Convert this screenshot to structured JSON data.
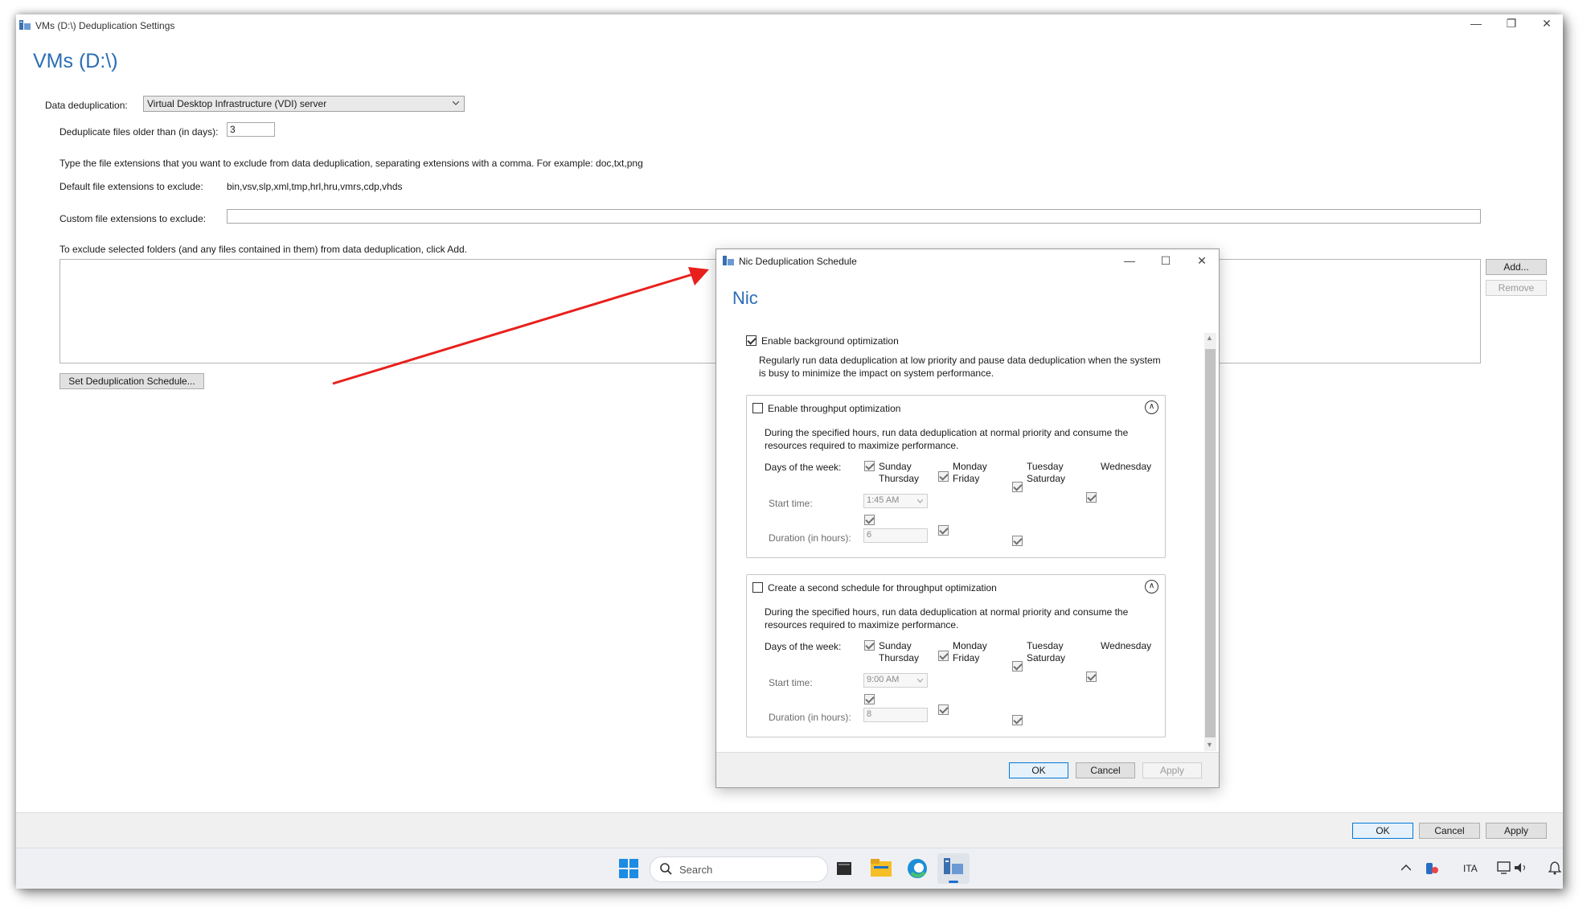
{
  "main": {
    "window_title": "VMs (D:\\) Deduplication Settings",
    "controls": {
      "minimize": "—",
      "restore": "❐",
      "close": "✕"
    },
    "heading": "VMs (D:\\)",
    "data_dedup_label": "Data deduplication:",
    "data_dedup_value": "Virtual Desktop Infrastructure (VDI) server",
    "older_than_label": "Deduplicate files older than (in days):",
    "older_than_value": "3",
    "instructions": "Type the file extensions that you want to exclude from data deduplication, separating extensions with a comma. For example: doc,txt,png",
    "default_ext_label": "Default file extensions to exclude:",
    "default_ext_value": "bin,vsv,slp,xml,tmp,hrl,hru,vmrs,cdp,vhds",
    "custom_ext_label": "Custom file extensions to exclude:",
    "custom_ext_value": "",
    "folders_instruction": "To exclude selected folders (and any files contained in them) from data deduplication, click Add.",
    "add_button": "Add...",
    "remove_button": "Remove",
    "schedule_button": "Set Deduplication Schedule...",
    "ok_button": "OK",
    "cancel_button": "Cancel",
    "apply_button": "Apply"
  },
  "dialog": {
    "title": "Nic Deduplication Schedule",
    "controls": {
      "minimize": "—",
      "maximize": "☐",
      "close": "✕"
    },
    "heading": "Nic",
    "background_opt": {
      "label": "Enable background optimization",
      "checked": true,
      "description": "Regularly run data deduplication at low priority and pause data deduplication when the system is busy to minimize the impact on system performance."
    },
    "schedules": [
      {
        "label": "Enable throughput optimization",
        "checked": false,
        "description": "During the specified hours, run data deduplication at normal priority and consume the resources required to maximize performance.",
        "days_label": "Days of the week:",
        "days": [
          "Sunday",
          "Monday",
          "Tuesday",
          "Wednesday",
          "Thursday",
          "Friday",
          "Saturday"
        ],
        "start_label": "Start time:",
        "start_value": "1:45 AM",
        "duration_label": "Duration (in hours):",
        "duration_value": "6"
      },
      {
        "label": "Create a second schedule for throughput optimization",
        "checked": false,
        "description": "During the specified hours, run data deduplication at normal priority and consume the resources required to maximize performance.",
        "days_label": "Days of the week:",
        "days": [
          "Sunday",
          "Monday",
          "Tuesday",
          "Wednesday",
          "Thursday",
          "Friday",
          "Saturday"
        ],
        "start_label": "Start time:",
        "start_value": "9:00 AM",
        "duration_label": "Duration (in hours):",
        "duration_value": "8"
      }
    ],
    "ok_button": "OK",
    "cancel_button": "Cancel",
    "apply_button": "Apply"
  },
  "taskbar": {
    "search_placeholder": "Search",
    "language": "ITA",
    "icons": [
      "windows-start-icon",
      "search-icon",
      "task-view-icon",
      "file-explorer-icon",
      "edge-icon",
      "server-manager-icon"
    ],
    "tray_icons": [
      "chevron-up-icon",
      "app-tray-icon",
      "network-icon",
      "volume-icon",
      "notification-bell-icon"
    ]
  },
  "annotation": {
    "arrow_color": "#e8201c"
  },
  "colors": {
    "accent": "#2a6db5",
    "primary_button_border": "#0078d7"
  }
}
